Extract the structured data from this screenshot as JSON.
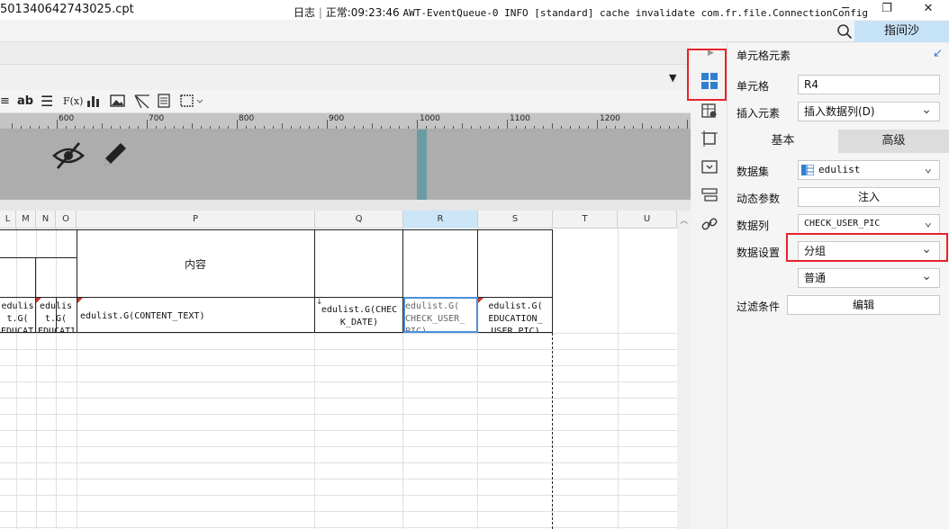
{
  "window": {
    "title": "501340642743025.cpt",
    "minimize": "─",
    "maximize": "❐",
    "close": "✕"
  },
  "logbar": {
    "log_label": "日志",
    "status": "正常:09:23:46",
    "message": "AWT-EventQueue-0 INFO [standard] cache invalidate com.fr.file.ConnectionConfig",
    "guide_button": "指间沙"
  },
  "toolbar": {
    "ab_label": "ab",
    "fx_label": "F(x)"
  },
  "ruler": {
    "labels": [
      "600",
      "700",
      "800",
      "900",
      "1000",
      "1100",
      "1200"
    ]
  },
  "columns": [
    "L",
    "M",
    "N",
    "O",
    "P",
    "Q",
    "R",
    "S",
    "T",
    "U"
  ],
  "cells": {
    "content_header": "内容",
    "l4": "edulis t.G( EDUCATI",
    "n4": "edulis t.G( EDUCATI",
    "p4": "edulist.G(CONTENT_TEXT)",
    "q4": "edulist.G(CHEC K_DATE)",
    "r4": "edulist.G( CHECK_USER_ PIC)",
    "s4": "edulist.G( EDUCATION_ USER_PIC)"
  },
  "panel": {
    "header": "单元格元素",
    "cell_label": "单元格",
    "cell_value": "R4",
    "insert_label": "插入元素",
    "insert_value": "插入数据列(D)",
    "tab_basic": "基本",
    "tab_advanced": "高级",
    "dataset_label": "数据集",
    "dataset_value": "edulist",
    "dynamic_label": "动态参数",
    "inject_button": "注入",
    "column_label": "数据列",
    "column_value": "CHECK_USER_PIC",
    "setting_label": "数据设置",
    "setting_value": "分组",
    "setting_value2": "普通",
    "filter_label": "过滤条件",
    "edit_button": "编辑"
  },
  "colors": {
    "accent": "#4a90d9",
    "highlight": "#e8222a",
    "guide_bg": "#c6e2f7"
  }
}
